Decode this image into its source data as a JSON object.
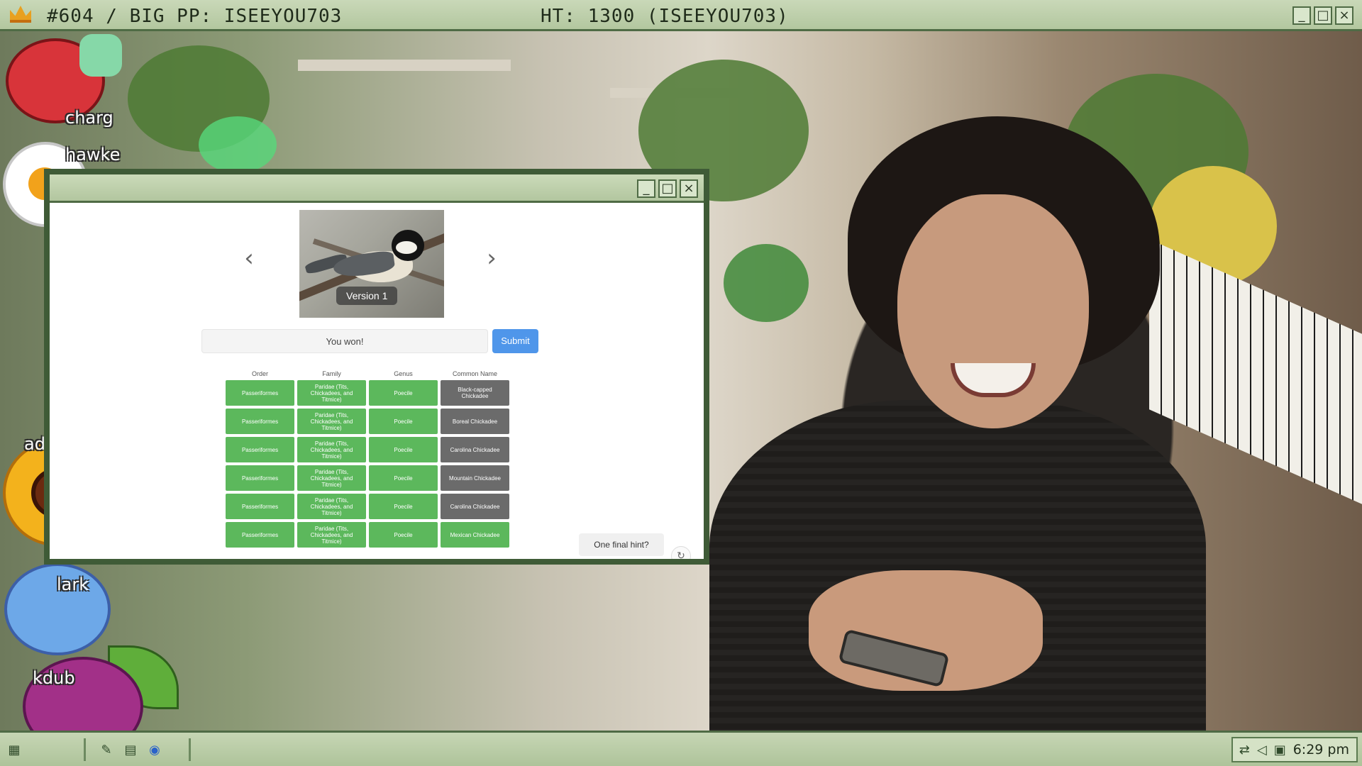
{
  "stream": {
    "top_left_text": "#604 / BIG PP: ISEEYOU703",
    "top_mid_text": "HT: 1300 (ISEEYOU703)",
    "window_controls": [
      "_",
      "□",
      "×"
    ],
    "names": [
      "charg",
      "hawke",
      "adopt",
      "lark",
      "kdub"
    ]
  },
  "app": {
    "window_controls": [
      "_",
      "□",
      "×"
    ],
    "image_badge": "Version 1",
    "prev_arrow": "‹",
    "next_arrow": "›",
    "guess_value": "You won!",
    "submit_label": "Submit",
    "hint_label": "One final hint?",
    "refresh_glyph": "↻",
    "table": {
      "headers": [
        "Order",
        "Family",
        "Genus",
        "Common Name"
      ],
      "rows": [
        {
          "order": "Passeriformes",
          "family": "Paridae (Tits, Chickadees, and Titmice)",
          "genus": "Poecile",
          "common": "Black-capped Chickadee",
          "common_color": "gray"
        },
        {
          "order": "Passeriformes",
          "family": "Paridae (Tits, Chickadees, and Titmice)",
          "genus": "Poecile",
          "common": "Boreal Chickadee",
          "common_color": "gray"
        },
        {
          "order": "Passeriformes",
          "family": "Paridae (Tits, Chickadees, and Titmice)",
          "genus": "Poecile",
          "common": "Carolina Chickadee",
          "common_color": "gray"
        },
        {
          "order": "Passeriformes",
          "family": "Paridae (Tits, Chickadees, and Titmice)",
          "genus": "Poecile",
          "common": "Mountain Chickadee",
          "common_color": "gray"
        },
        {
          "order": "Passeriformes",
          "family": "Paridae (Tits, Chickadees, and Titmice)",
          "genus": "Poecile",
          "common": "Carolina Chickadee",
          "common_color": "gray"
        },
        {
          "order": "Passeriformes",
          "family": "Paridae (Tits, Chickadees, and Titmice)",
          "genus": "Poecile",
          "common": "Mexican Chickadee",
          "common_color": "green"
        }
      ]
    }
  },
  "taskbar": {
    "clock": "6:29 pm"
  },
  "colors": {
    "frame_green": "#3f5b37",
    "cell_green": "#5cb85c",
    "cell_gray": "#6b6b6b",
    "submit_blue": "#4f96ea"
  },
  "icons": [
    "crown-icon",
    "start-icon",
    "notepad-icon",
    "folder-icon",
    "browser-icon",
    "network-icon",
    "volume-icon",
    "display-icon"
  ]
}
